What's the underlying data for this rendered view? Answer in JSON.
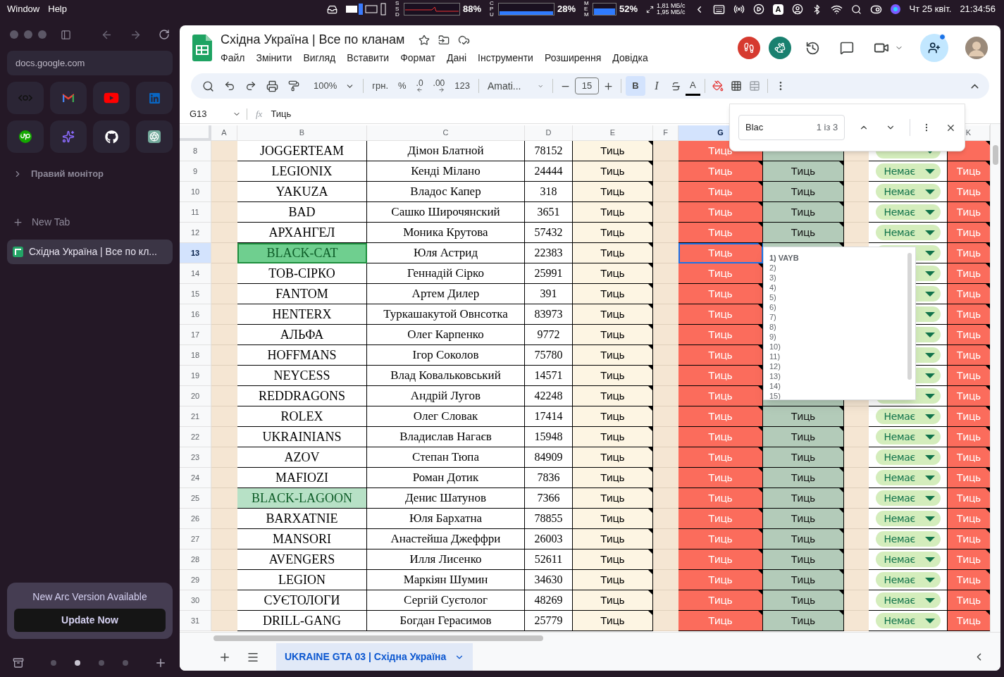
{
  "menubar": {
    "menus": [
      "Window",
      "Help"
    ],
    "ssd_label": "SSD",
    "ssd": "88%",
    "cpu_label": "CPU",
    "cpu": "28%",
    "mem_label": "MEM",
    "mem": "52%",
    "net_up": "1,81 МБ/с",
    "net_down": "1,95 МБ/с",
    "input_source": "A",
    "date": "Чт 25 квіт.",
    "time": "21:34:56"
  },
  "sidebar": {
    "url": "docs.google.com",
    "folder": "Правий монітор",
    "new_tab": "New Tab",
    "tabs": [
      {
        "title": "Східна Україна | Все по кл...",
        "selected": true
      }
    ],
    "update": {
      "title": "New Arc Version Available",
      "button": "Update Now"
    },
    "spaces": [
      {
        "selected": false
      },
      {
        "selected": true
      },
      {
        "selected": false
      },
      {
        "selected": false
      }
    ]
  },
  "doc": {
    "title": "Східна Україна | Все по кланам",
    "menus": [
      "Файл",
      "Змінити",
      "Вигляд",
      "Вставити",
      "Формат",
      "Дані",
      "Інструменти",
      "Розширення",
      "Довідка"
    ]
  },
  "toolbar": {
    "zoom": "100%",
    "currency": "грн.",
    "percent": "%",
    "decrease_decimals": ".0",
    "increase_decimals": ".00",
    "number_format": "123",
    "font": "Amati...",
    "font_size": "15",
    "bold": {
      "label": "B",
      "selected": true
    },
    "italic": {
      "label": "I",
      "selected": false
    },
    "text_color": "A"
  },
  "formula_bar": {
    "cell": "G13",
    "fx": "fx",
    "formula": "Тиць"
  },
  "columns": [
    {
      "label": "A",
      "selected": false
    },
    {
      "label": "B",
      "selected": false
    },
    {
      "label": "C",
      "selected": false
    },
    {
      "label": "D",
      "selected": false
    },
    {
      "label": "E",
      "selected": false
    },
    {
      "label": "F",
      "selected": false
    },
    {
      "label": "G",
      "selected": true
    },
    {
      "label": "K",
      "selected": false
    }
  ],
  "rows": [
    {
      "n": "8",
      "b": "JOGGERTEAM",
      "c": "Дімон Блатной",
      "d": "78152",
      "e": "Тиць",
      "g": "Тиць",
      "found": false,
      "current": false,
      "selected": false
    },
    {
      "n": "9",
      "b": "LEGIONIX",
      "c": "Кенді Мілано",
      "d": "24444",
      "e": "Тиць",
      "g": "Тиць",
      "h": "Тиць",
      "j": "Немає",
      "k": "Тиць",
      "found": false,
      "current": false,
      "selected": false
    },
    {
      "n": "10",
      "b": "YAKUZA",
      "c": "Владос Капер",
      "d": "318",
      "e": "Тиць",
      "g": "Тиць",
      "h": "Тиць",
      "j": "Немає",
      "k": "Тиць",
      "found": false,
      "current": false,
      "selected": false
    },
    {
      "n": "11",
      "b": "BAD",
      "c": "Сашко Широчянский",
      "d": "3651",
      "e": "Тиць",
      "g": "Тиць",
      "h": "Тиць",
      "j": "Немає",
      "k": "Тиць",
      "found": false,
      "current": false,
      "selected": false
    },
    {
      "n": "12",
      "b": "АРХАНГЕЛ",
      "c": "Моника Крутова",
      "d": "57432",
      "e": "Тиць",
      "g": "Тиць",
      "h": "Тиць",
      "j": "Немає",
      "k": "Тиць",
      "found": false,
      "current": false,
      "selected": false
    },
    {
      "n": "13",
      "b": "BLACK-CAT",
      "c": "Юля Астрид",
      "d": "22383",
      "e": "Тиць",
      "g": "Тиць",
      "k": "Тиць",
      "found": true,
      "current": true,
      "selected": true
    },
    {
      "n": "14",
      "b": "ТОВ-СІРКО",
      "c": "Геннадій Сірко",
      "d": "25991",
      "e": "Тиць",
      "g": "Тиць",
      "k": "Тиць",
      "found": false,
      "current": false,
      "selected": false
    },
    {
      "n": "15",
      "b": "FANTOM",
      "c": "Артем Дилер",
      "d": "391",
      "e": "Тиць",
      "g": "Тиць",
      "k": "Тиць",
      "found": false,
      "current": false,
      "selected": false
    },
    {
      "n": "16",
      "b": "HENTERX",
      "c": "Туркашакутой Овнсотка",
      "d": "83973",
      "e": "Тиць",
      "g": "Тиць",
      "k": "Тиць",
      "found": false,
      "current": false,
      "selected": false
    },
    {
      "n": "17",
      "b": "АЛЬФА",
      "c": "Олег Карпенко",
      "d": "9772",
      "e": "Тиць",
      "g": "Тиць",
      "k": "Тиць",
      "found": false,
      "current": false,
      "selected": false
    },
    {
      "n": "18",
      "b": "HOFFMANS",
      "c": "Ігор Соколов",
      "d": "75780",
      "e": "Тиць",
      "g": "Тиць",
      "k": "Тиць",
      "found": false,
      "current": false,
      "selected": false
    },
    {
      "n": "19",
      "b": "NEYCESS",
      "c": "Влад Ковальковський",
      "d": "14571",
      "e": "Тиць",
      "g": "Тиць",
      "k": "Тиць",
      "found": false,
      "current": false,
      "selected": false
    },
    {
      "n": "20",
      "b": "REDDRAGONS",
      "c": "Андрій Лугов",
      "d": "42248",
      "e": "Тиць",
      "g": "Тиць",
      "k": "Тиць",
      "found": false,
      "current": false,
      "selected": false
    },
    {
      "n": "21",
      "b": "ROLEX",
      "c": "Олег Словак",
      "d": "17414",
      "e": "Тиць",
      "g": "Тиць",
      "h": "Тиць",
      "j": "Немає",
      "k": "Тиць",
      "found": false,
      "current": false,
      "selected": false
    },
    {
      "n": "22",
      "b": "UKRAINIANS",
      "c": "Владислав Нагаєв",
      "d": "15948",
      "e": "Тиць",
      "g": "Тиць",
      "h": "Тиць",
      "j": "Немає",
      "k": "Тиць",
      "found": false,
      "current": false,
      "selected": false
    },
    {
      "n": "23",
      "b": "AZOV",
      "c": "Степан Тюпа",
      "d": "84909",
      "e": "Тиць",
      "g": "Тиць",
      "h": "Тиць",
      "j": "Немає",
      "k": "Тиць",
      "found": false,
      "current": false,
      "selected": false
    },
    {
      "n": "24",
      "b": "MAFIOZI",
      "c": "Роман Дотик",
      "d": "7836",
      "e": "Тиць",
      "g": "Тиць",
      "h": "Тиць",
      "j": "Немає",
      "k": "Тиць",
      "found": false,
      "current": false,
      "selected": false
    },
    {
      "n": "25",
      "b": "BLACK-LAGOON",
      "c": "Денис Шатунов",
      "d": "7366",
      "e": "Тиць",
      "g": "Тиць",
      "h": "Тиць",
      "j": "Немає",
      "k": "Тиць",
      "found": true,
      "current": false,
      "selected": false
    },
    {
      "n": "26",
      "b": "BARXATNIE",
      "c": "Юля Бархатна",
      "d": "78855",
      "e": "Тиць",
      "g": "Тиць",
      "h": "Тиць",
      "j": "Немає",
      "k": "Тиць",
      "found": false,
      "current": false,
      "selected": false
    },
    {
      "n": "27",
      "b": "MANSORI",
      "c": "Анастейша Джеффри",
      "d": "26003",
      "e": "Тиць",
      "g": "Тиць",
      "h": "Тиць",
      "j": "Немає",
      "k": "Тиць",
      "found": false,
      "current": false,
      "selected": false
    },
    {
      "n": "28",
      "b": "AVENGERS",
      "c": "Илля Лисенко",
      "d": "52611",
      "e": "Тиць",
      "g": "Тиць",
      "h": "Тиць",
      "j": "Немає",
      "k": "Тиць",
      "found": false,
      "current": false,
      "selected": false
    },
    {
      "n": "29",
      "b": "LEGION",
      "c": "Маркіян Шумин",
      "d": "34630",
      "e": "Тиць",
      "g": "Тиць",
      "h": "Тиць",
      "j": "Немає",
      "k": "Тиць",
      "found": false,
      "current": false,
      "selected": false
    },
    {
      "n": "30",
      "b": "СУЄТОЛОГИ",
      "c": "Сергій Суєтолог",
      "d": "48269",
      "e": "Тиць",
      "g": "Тиць",
      "h": "Тиць",
      "j": "Немає",
      "k": "Тиць",
      "found": false,
      "current": false,
      "selected": false
    },
    {
      "n": "31",
      "b": "DRILL-GANG",
      "c": "Богдан Герасимов",
      "d": "25779",
      "e": "Тиць",
      "g": "Тиць",
      "h": "Тиць",
      "j": "Немає",
      "k": "Тиць",
      "found": false,
      "current": false,
      "selected": false
    }
  ],
  "find": {
    "query": "Blac",
    "count": "1 із 3"
  },
  "note": {
    "lines": [
      "1) VAYB",
      "2)",
      "3)",
      "4)",
      "5)",
      "6)",
      "7)",
      "8)",
      "9)",
      "10)",
      "11)",
      "12)",
      "13)",
      "14)",
      "15)"
    ]
  },
  "sheet_tabs": [
    {
      "label": "UKRAINE GTA 03 | Східна Україна",
      "selected": true
    }
  ]
}
